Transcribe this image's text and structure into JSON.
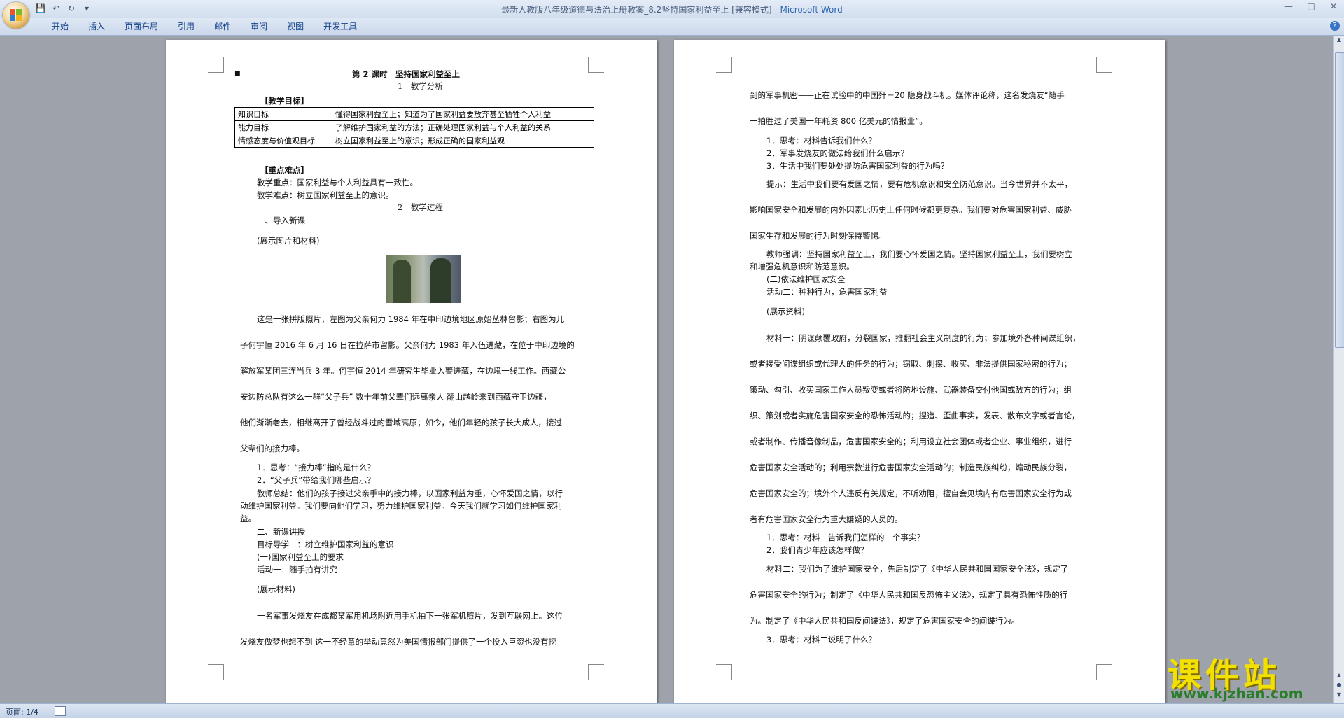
{
  "window": {
    "title": "最新人教版八年级道德与法治上册教案_8.2坚持国家利益至上 [兼容模式]",
    "app_name": "Microsoft Word"
  },
  "ribbon": {
    "tabs": [
      "开始",
      "插入",
      "页面布局",
      "引用",
      "邮件",
      "审阅",
      "视图",
      "开发工具"
    ]
  },
  "status": {
    "page": "页面: 1/4"
  },
  "left_page": {
    "title": "第 2 课时　坚持国家利益至上",
    "h1": "1　教学分析",
    "objectives_header": "【教学目标】",
    "objectives": [
      {
        "k": "知识目标",
        "v": "懂得国家利益至上；知道为了国家利益要放弃甚至牺牲个人利益"
      },
      {
        "k": "能力目标",
        "v": "了解维护国家利益的方法；正确处理国家利益与个人利益的关系"
      },
      {
        "k": "情感态度与价值观目标",
        "v": "树立国家利益至上的意识；形成正确的国家利益观"
      }
    ],
    "key_header": "【重点难点】",
    "key_point": "教学重点：国家利益与个人利益具有一致性。",
    "difficulty": "教学难点：树立国家利益至上的意识。",
    "h2": "2　教学过程",
    "intro": "一、导入新课",
    "show1": "(展示图片和材料)",
    "para1": [
      "这是一张拼版照片，左图为父亲何力 1984 年在中印边境地区原始丛林留影；右图为儿",
      "子何宇恒 2016 年 6 月 16 日在拉萨市留影。父亲何力 1983 年入伍进藏，在位于中印边境的",
      "解放军某团三连当兵 3 年。何宇恒 2014 年研究生毕业入警进藏，在边境一线工作。西藏公",
      "安边防总队有这么一群“父子兵” 数十年前父辈们远离亲人 翻山越岭来到西藏守卫边疆，",
      "他们渐渐老去，相继离开了曾经战斗过的雪域高原；如今，他们年轻的孩子长大成人，接过",
      "父辈们的接力棒。"
    ],
    "q1": "1．思考：“接力棒”指的是什么？",
    "q2": "2．“父子兵”带给我们哪些启示？",
    "summary": [
      "教师总结：他们的孩子接过父亲手中的接力棒，以国家利益为重，心怀爱国之情，以行",
      "动维护国家利益。我们要向他们学习，努力维护国家利益。今天我们就学习如何维护国家利",
      "益。"
    ],
    "sec2": "二、新课讲授",
    "goal1": "目标导学一：树立维护国家利益的意识",
    "sub1": "(一)国家利益至上的要求",
    "act1": "活动一：随手拍有讲究",
    "show2": "(展示材料)",
    "para2": [
      "一名军事发烧友在成都某军用机场附近用手机拍下一张军机照片，发到互联网上。这位",
      "发烧友做梦也想不到 这一不经意的举动竟然为美国情报部门提供了一个投入巨资也没有挖"
    ]
  },
  "right_page": {
    "cont": [
      "到的军事机密——正在试验中的中国歼－20 隐身战斗机。媒体评论称，这名发烧友“随手",
      "一拍胜过了美国一年耗资 800 亿美元的情报业”。"
    ],
    "qs1": [
      "1．思考：材料告诉我们什么？",
      "2．军事发烧友的做法给我们什么启示？",
      "3．生活中我们要处处提防危害国家利益的行为吗？"
    ],
    "tip": [
      "提示：生活中我们要有爱国之情，要有危机意识和安全防范意识。当今世界并不太平，",
      "影响国家安全和发展的内外因素比历史上任何时候都更复杂。我们要对危害国家利益、威胁",
      "国家生存和发展的行为时刻保持警惕。"
    ],
    "stress": [
      "教师强调：坚持国家利益至上，我们要心怀爱国之情。坚持国家利益至上，我们要树立",
      "和增强危机意识和防范意识。"
    ],
    "sub2": "(二)依法维护国家安全",
    "act2": "活动二：种种行为，危害国家利益",
    "show3": "(展示资料)",
    "m1": [
      "材料一：阴谋颠覆政府，分裂国家，推翻社会主义制度的行为；参加境外各种间谍组织，",
      "或者接受间谍组织或代理人的任务的行为；窃取、刺探、收买、非法提供国家秘密的行为；",
      "策动、勾引、收买国家工作人员叛变或者将防地设施、武器装备交付他国或敌方的行为；组",
      "织、策划或者实施危害国家安全的恐怖活动的；捏造、歪曲事实，发表、散布文字或者言论，",
      "或者制作、传播音像制品，危害国家安全的；利用设立社会团体或者企业、事业组织，进行",
      "危害国家安全活动的；利用宗教进行危害国家安全活动的；制造民族纠纷，煽动民族分裂，",
      "危害国家安全的；境外个人违反有关规定，不听劝阻，擅自会见境内有危害国家安全行为或",
      "者有危害国家安全行为重大嫌疑的人员的。"
    ],
    "qs2": [
      "1．思考：材料一告诉我们怎样的一个事实？",
      "2．我们青少年应该怎样做？"
    ],
    "m2": [
      "材料二：我们为了维护国家安全，先后制定了《中华人民共和国国家安全法》，规定了",
      "危害国家安全的行为；制定了《中华人民共和国反恐怖主义法》，规定了具有恐怖性质的行",
      "为。制定了《中华人民共和国反间谍法》，规定了危害国家安全的间谍行为。"
    ],
    "q3": "3．思考：材料二说明了什么？"
  },
  "watermark": {
    "cn": "课件站",
    "url": "www.kjzhan.com"
  }
}
